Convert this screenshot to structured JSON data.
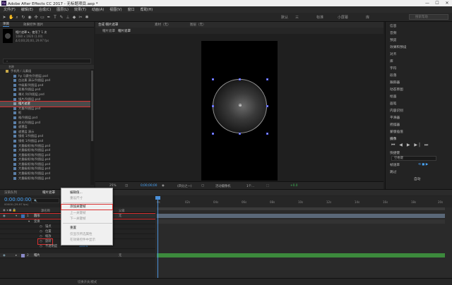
{
  "window": {
    "title": "Adobe After Effects CC 2017 - 无标题项目.aep *",
    "controls": [
      "—",
      "☐",
      "✕"
    ]
  },
  "menu": [
    "文件(F)",
    "编辑(E)",
    "合成(C)",
    "图层(L)",
    "效果(T)",
    "动画(A)",
    "视图(V)",
    "窗口",
    "帮助(H)"
  ],
  "workspaces": [
    "默认",
    "三",
    "标准",
    "小屏幕",
    "库"
  ],
  "search_help": "搜索帮助",
  "project": {
    "tab": "项目",
    "tab2": "效果控件 图片",
    "item_name": "帽片遮罩 ▾，使用了 1 次",
    "item_size": "1080 x 1920 (1.00)",
    "item_dur": "Δ 0;00;20;00, 29.97 fps",
    "col_name": "名称",
    "items": [
      {
        "t": "folder",
        "label": "手机壳 / 元素组"
      },
      {
        "t": "file",
        "label": "hy 马赛克/列图层.psd"
      },
      {
        "t": "file",
        "label": "白边素 演示/列图层.psd"
      },
      {
        "t": "file",
        "label": "中级素/列图层.psd"
      },
      {
        "t": "file",
        "label": "背景/列图层.psd"
      },
      {
        "t": "file",
        "label": "曝光 列/列图层.psd"
      },
      {
        "t": "file",
        "label": "镜片/列图层.psd"
      },
      {
        "t": "comp",
        "label": "帽片遮罩",
        "sel": true
      },
      {
        "t": "file",
        "label": "大量/列图层.psd"
      },
      {
        "t": "file",
        "label": "框"
      },
      {
        "t": "file",
        "label": "格/列图层.psd"
      },
      {
        "t": "file",
        "label": "底光/列图层.psd"
      },
      {
        "t": "file",
        "label": "遮罩层"
      },
      {
        "t": "file",
        "label": "遮罩层 演示"
      },
      {
        "t": "file",
        "label": "镜框 1/列图层.psd"
      },
      {
        "t": "file",
        "label": "镜框 1/列图层.psd"
      },
      {
        "t": "file",
        "label": "大量级框/效/列图层.psd"
      },
      {
        "t": "file",
        "label": "大量级框/效/列图层.psd"
      },
      {
        "t": "file",
        "label": "大量级框/效/列图层.psd"
      },
      {
        "t": "file",
        "label": "大量级框/效/列图层.psd"
      },
      {
        "t": "file",
        "label": "大量级框/效/列图层.psd"
      },
      {
        "t": "file",
        "label": "大量级框/效/列图层.psd"
      },
      {
        "t": "file",
        "label": "大量级框/效/列图层.psd"
      },
      {
        "t": "file",
        "label": "大量级框/效/列图层.psd"
      }
    ],
    "footer": "8 bpc"
  },
  "viewer": {
    "hdr": [
      "合成 帽片遮罩",
      "素材（无）",
      "图层（无）"
    ],
    "tabs": [
      "帽片遮罩",
      "帽片遮罩"
    ],
    "bar": [
      "25%",
      "◫",
      "0;00;00;00",
      "◉",
      "(四分之一)",
      "▢",
      "活动摄像机",
      "1个...",
      "⬚",
      "+0.0"
    ]
  },
  "right": {
    "items": [
      "信息",
      "音频",
      "预览",
      "效果和预设",
      "对齐",
      "库",
      "字符",
      "段落",
      "跟踪器",
      "动态草图",
      "绘画",
      "画笔",
      "内容识别",
      "平滑器",
      "摇摆器",
      "蒙版插值",
      "摄像"
    ],
    "pb_label": "快捷键",
    "pb": "⏮ ◀ ▶ ▶| ⏭",
    "fps_label": "帧速率",
    "fps": "空格键",
    "skip": "跳过",
    "res": "自动"
  },
  "timeline": {
    "hdr": [
      "渲染队列",
      "帽片遮罩"
    ],
    "time": "0:00:00:00",
    "frames": "00000 (29.97 fps)",
    "search": "🔍",
    "cols": [
      "源名称",
      "单 ☆ \\fx▣ ◎ ◐ ◯",
      "父级"
    ],
    "layers": [
      {
        "num": "1",
        "name": "圆形",
        "parent": "无"
      },
      {
        "num": "",
        "name": "变换",
        "parent": ""
      },
      {
        "num": "",
        "name": "锚点",
        "parent": ""
      },
      {
        "num": "",
        "name": "位置",
        "parent": ""
      },
      {
        "num": "",
        "name": "缩放",
        "parent": ""
      },
      {
        "num": "",
        "name": "旋转",
        "parent": ""
      },
      {
        "num": "",
        "name": "不透明度",
        "parent": "100%"
      },
      {
        "num": "2",
        "name": "帽片",
        "parent": "无"
      }
    ],
    "ruler": [
      "0s",
      "02s",
      "04s",
      "06s",
      "08s",
      "10s",
      "12s",
      "14s",
      "16s",
      "18s",
      "20s"
    ],
    "footer": "切换开关/模式"
  },
  "context_menu": [
    {
      "l": "编辑值...",
      "d": false
    },
    {
      "l": "重设尺寸",
      "d": true
    },
    {
      "l": "添加关键帧",
      "d": false,
      "hl": true
    },
    {
      "l": "上一关键帧",
      "d": true
    },
    {
      "l": "下一关键帧",
      "d": true
    },
    {
      "l": "重置",
      "d": false
    },
    {
      "l": "仅显示所选属性",
      "d": true
    },
    {
      "l": "在效果控件中显示",
      "d": true
    }
  ],
  "colors": {
    "accent": "#4a90d9",
    "timecode": "#4aa8ff",
    "highlight": "#d93030",
    "track1": "#5a6878",
    "track2": "#3c8a3c"
  }
}
